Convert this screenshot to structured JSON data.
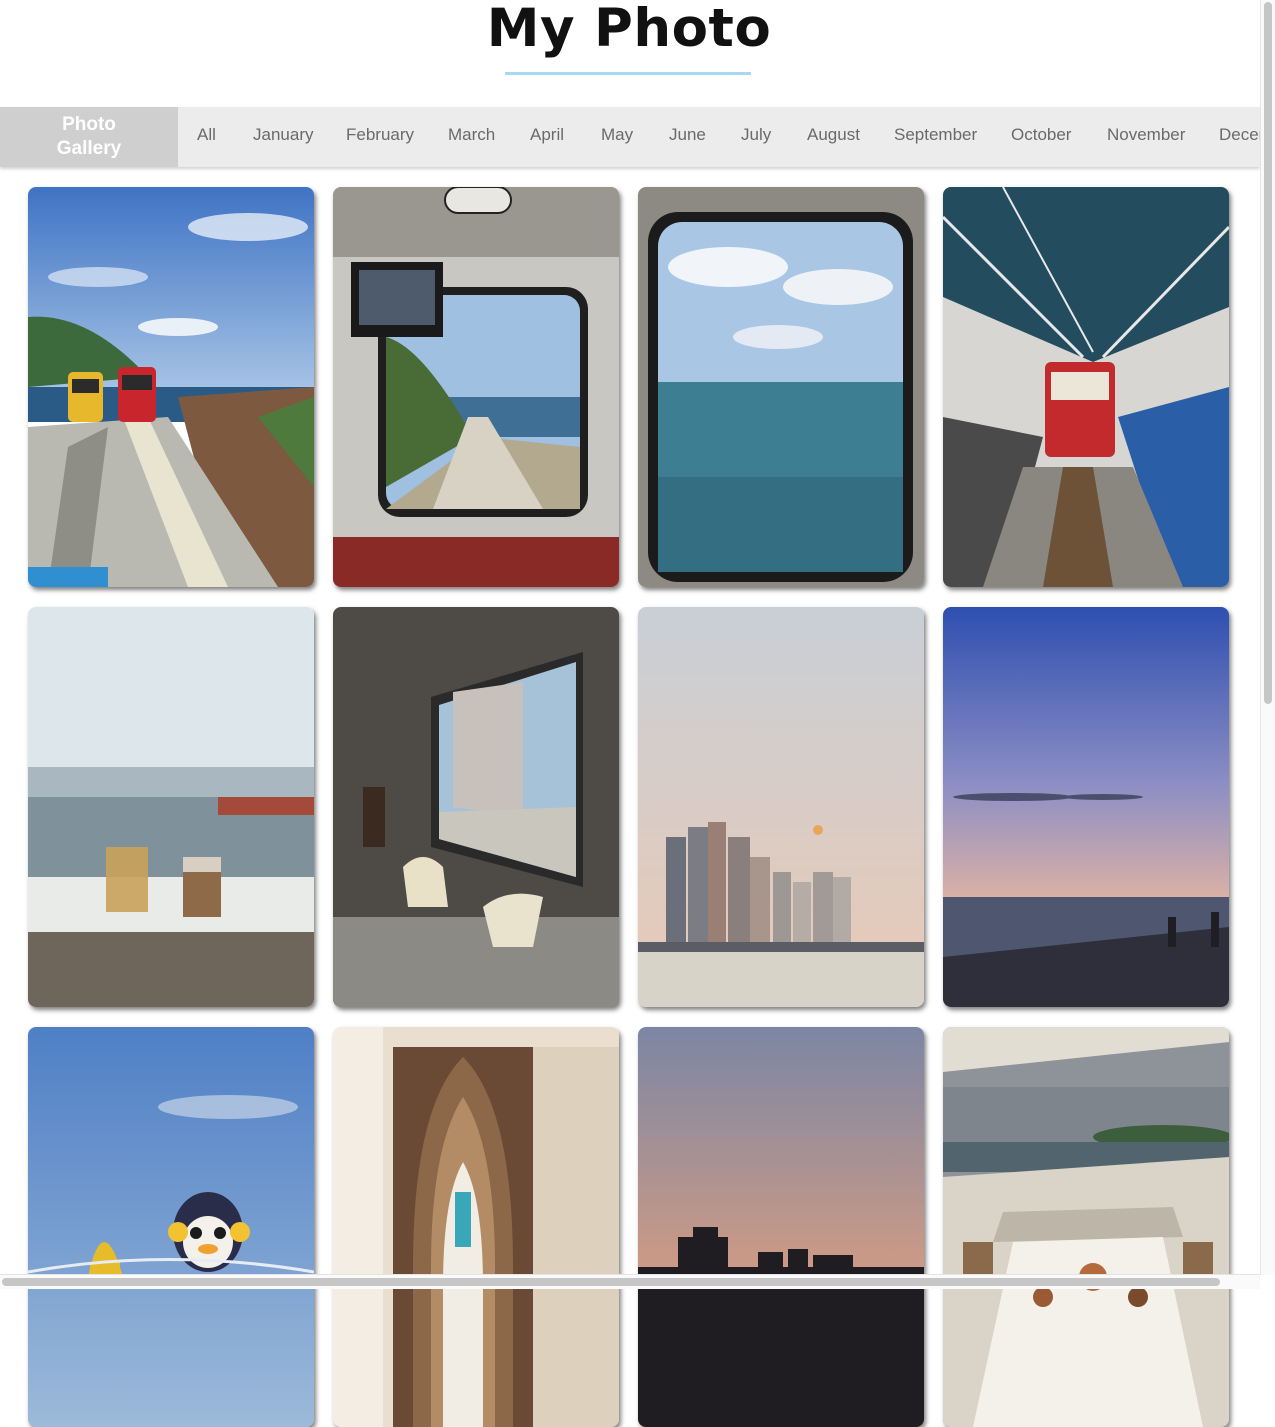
{
  "page": {
    "title": "My Photo"
  },
  "nav": {
    "brand": [
      "Photo",
      "Gallery"
    ],
    "items": [
      "All",
      "January",
      "February",
      "March",
      "April",
      "May",
      "June",
      "July",
      "August",
      "September",
      "October",
      "November",
      "December"
    ]
  },
  "gallery": {
    "photos": [
      {
        "subject": "coastal sky capsule tram tracks"
      },
      {
        "subject": "tram cabin window view of track"
      },
      {
        "subject": "sea through tram window"
      },
      {
        "subject": "red tram at station platform"
      },
      {
        "subject": "iced drinks by harbor window"
      },
      {
        "subject": "cafe interior with window and chairs"
      },
      {
        "subject": "city skyline at dusk with moon"
      },
      {
        "subject": "beach at twilight"
      },
      {
        "subject": "penguin figure and surfboard with bridge"
      },
      {
        "subject": "wooden gothic arch doorway"
      },
      {
        "subject": "sunset skyline silhouettes"
      },
      {
        "subject": "yacht deck dining table by sea"
      }
    ]
  },
  "colors": {
    "accent_underline": "#a9d8f5",
    "nav_bg": "#ececec",
    "brand_bg": "#cfcfcf"
  }
}
